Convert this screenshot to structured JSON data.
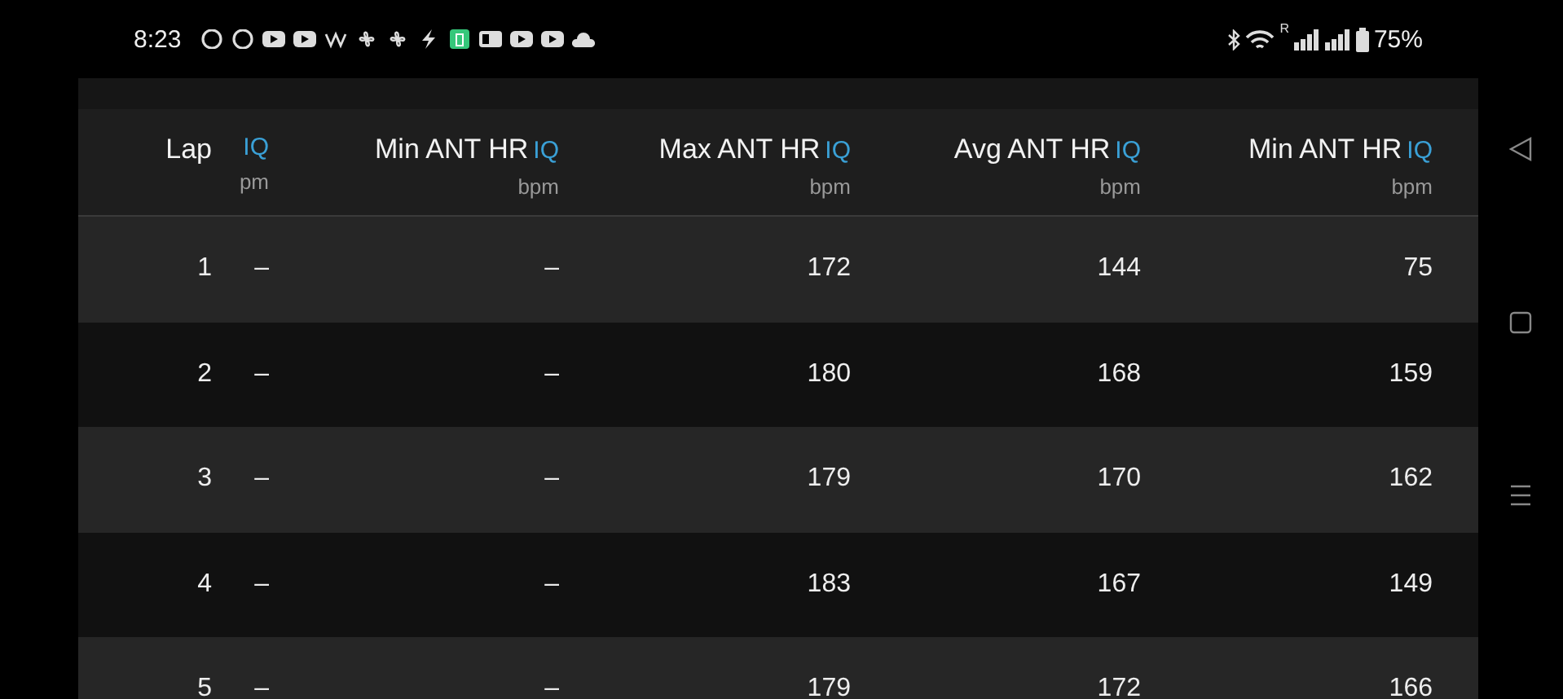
{
  "status_bar": {
    "time": "8:23",
    "battery": "75%",
    "network_label": "R"
  },
  "table": {
    "columns": [
      {
        "title": "Lap"
      },
      {
        "badge": "IQ",
        "unit": "pm"
      },
      {
        "title": "Min ANT HR",
        "badge": "IQ",
        "unit": "bpm"
      },
      {
        "title": "Max ANT HR",
        "badge": "IQ",
        "unit": "bpm"
      },
      {
        "title": "Avg ANT HR",
        "badge": "IQ",
        "unit": "bpm"
      },
      {
        "title": "Min ANT HR",
        "badge": "IQ",
        "unit": "bpm"
      }
    ],
    "rows": [
      [
        "1",
        "–",
        "–",
        "172",
        "144",
        "75"
      ],
      [
        "2",
        "–",
        "–",
        "180",
        "168",
        "159"
      ],
      [
        "3",
        "–",
        "–",
        "179",
        "170",
        "162"
      ],
      [
        "4",
        "–",
        "–",
        "183",
        "167",
        "149"
      ],
      [
        "5",
        "–",
        "–",
        "179",
        "172",
        "166"
      ]
    ]
  }
}
